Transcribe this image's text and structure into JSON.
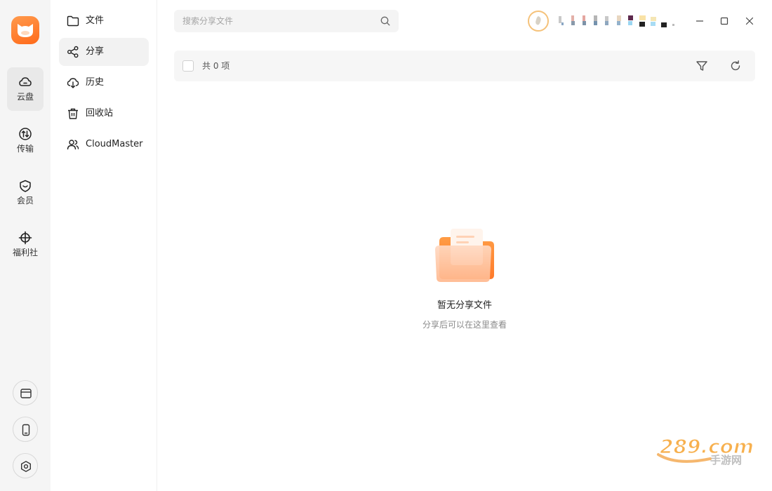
{
  "rail": {
    "items": [
      {
        "label": "云盘",
        "icon": "cloud-icon",
        "active": true
      },
      {
        "label": "传输",
        "icon": "transfer-icon",
        "active": false
      },
      {
        "label": "会员",
        "icon": "member-shield-icon",
        "active": false
      },
      {
        "label": "福利社",
        "icon": "welfare-icon",
        "active": false
      }
    ],
    "bottom_buttons": [
      "window-icon",
      "phone-icon",
      "settings-hexagon-icon"
    ]
  },
  "sidebar": {
    "items": [
      {
        "label": "文件",
        "icon": "folder-icon",
        "active": false
      },
      {
        "label": "分享",
        "icon": "share-icon",
        "active": true
      },
      {
        "label": "历史",
        "icon": "history-download-icon",
        "active": false
      },
      {
        "label": "回收站",
        "icon": "trash-icon",
        "active": false
      },
      {
        "label": "CloudMaster",
        "icon": "users-icon",
        "active": false
      }
    ]
  },
  "search": {
    "placeholder": "搜索分享文件",
    "value": ""
  },
  "toolbar": {
    "count_text": "共 0 项"
  },
  "empty": {
    "title": "暂无分享文件",
    "subtitle": "分享后可以在这里查看"
  },
  "watermark": {
    "text": "289.com",
    "sub": "手游网"
  },
  "colors": {
    "accent": "#ff6a1a",
    "rail_bg": "#f5f5f5",
    "active_bg": "#e9e9e9",
    "toolbar_bg": "#f6f6f6"
  }
}
